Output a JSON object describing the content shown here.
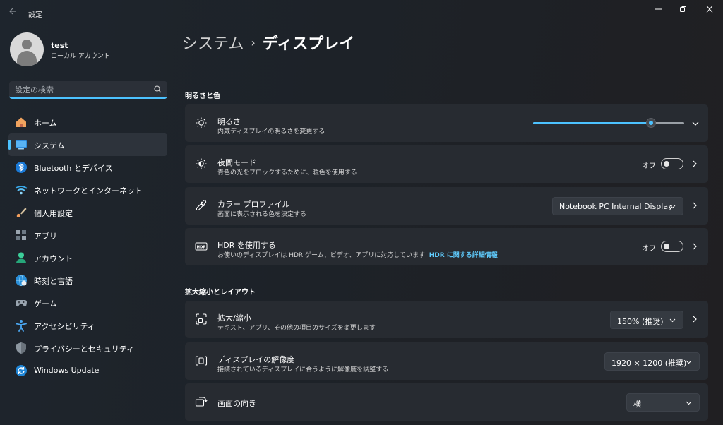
{
  "window": {
    "title": "設定"
  },
  "profile": {
    "name": "test",
    "account_type": "ローカル アカウント"
  },
  "search": {
    "placeholder": "設定の検索"
  },
  "sidebar": {
    "items": [
      {
        "label": "ホーム",
        "icon": "home-icon"
      },
      {
        "label": "システム",
        "icon": "system-icon",
        "selected": true
      },
      {
        "label": "Bluetooth とデバイス",
        "icon": "bluetooth-icon"
      },
      {
        "label": "ネットワークとインターネット",
        "icon": "network-icon"
      },
      {
        "label": "個人用設定",
        "icon": "personalization-icon"
      },
      {
        "label": "アプリ",
        "icon": "apps-icon"
      },
      {
        "label": "アカウント",
        "icon": "accounts-icon"
      },
      {
        "label": "時刻と言語",
        "icon": "time-language-icon"
      },
      {
        "label": "ゲーム",
        "icon": "gaming-icon"
      },
      {
        "label": "アクセシビリティ",
        "icon": "accessibility-icon"
      },
      {
        "label": "プライバシーとセキュリティ",
        "icon": "privacy-icon"
      },
      {
        "label": "Windows Update",
        "icon": "windows-update-icon"
      }
    ]
  },
  "breadcrumb": {
    "parent": "システム",
    "separator": "›",
    "current": "ディスプレイ"
  },
  "sections": {
    "brightness_color": "明るさと色",
    "scale_layout": "拡大縮小とレイアウト"
  },
  "settings": {
    "brightness": {
      "title": "明るさ",
      "description": "内蔵ディスプレイの明るさを変更する",
      "value": 0.78
    },
    "night_light": {
      "title": "夜間モード",
      "description": "青色の光をブロックするために、暖色を使用する",
      "state": "オフ"
    },
    "color_profile": {
      "title": "カラー プロファイル",
      "description": "画面に表示される色を決定する",
      "value": "Notebook PC Internal Display"
    },
    "hdr": {
      "title": "HDR を使用する",
      "description": "お使いのディスプレイは HDR ゲーム、ビデオ、アプリに対応しています",
      "link": "HDR に関する詳細情報",
      "state": "オフ"
    },
    "scale": {
      "title": "拡大/縮小",
      "description": "テキスト、アプリ、その他の項目のサイズを変更します",
      "value": "150% (推奨)"
    },
    "resolution": {
      "title": "ディスプレイの解像度",
      "description": "接続されているディスプレイに合うように解像度を調整する",
      "value": "1920 × 1200 (推奨)"
    },
    "orientation": {
      "title": "画面の向き",
      "value": "横"
    }
  },
  "colors": {
    "accent": "#4cc2ff",
    "link": "#60cdff",
    "card": "#272b31"
  }
}
